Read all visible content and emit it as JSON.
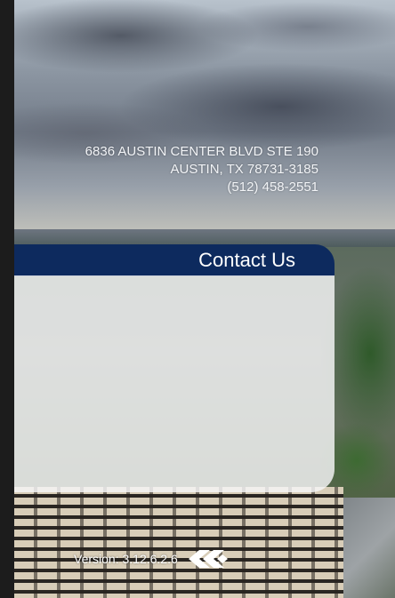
{
  "address": {
    "line1": "6836 AUSTIN CENTER BLVD STE 190",
    "line2": "AUSTIN, TX 78731-3185",
    "phone": "(512) 458-2551"
  },
  "contact": {
    "title": "Contact Us"
  },
  "footer": {
    "version": "Version: 3.12.6.2.6",
    "logo_icon": "chevron-logo-icon"
  },
  "colors": {
    "header_bg": "#0d2a5e",
    "panel_bg": "#f6f6f8",
    "text_light": "#ffffff"
  }
}
